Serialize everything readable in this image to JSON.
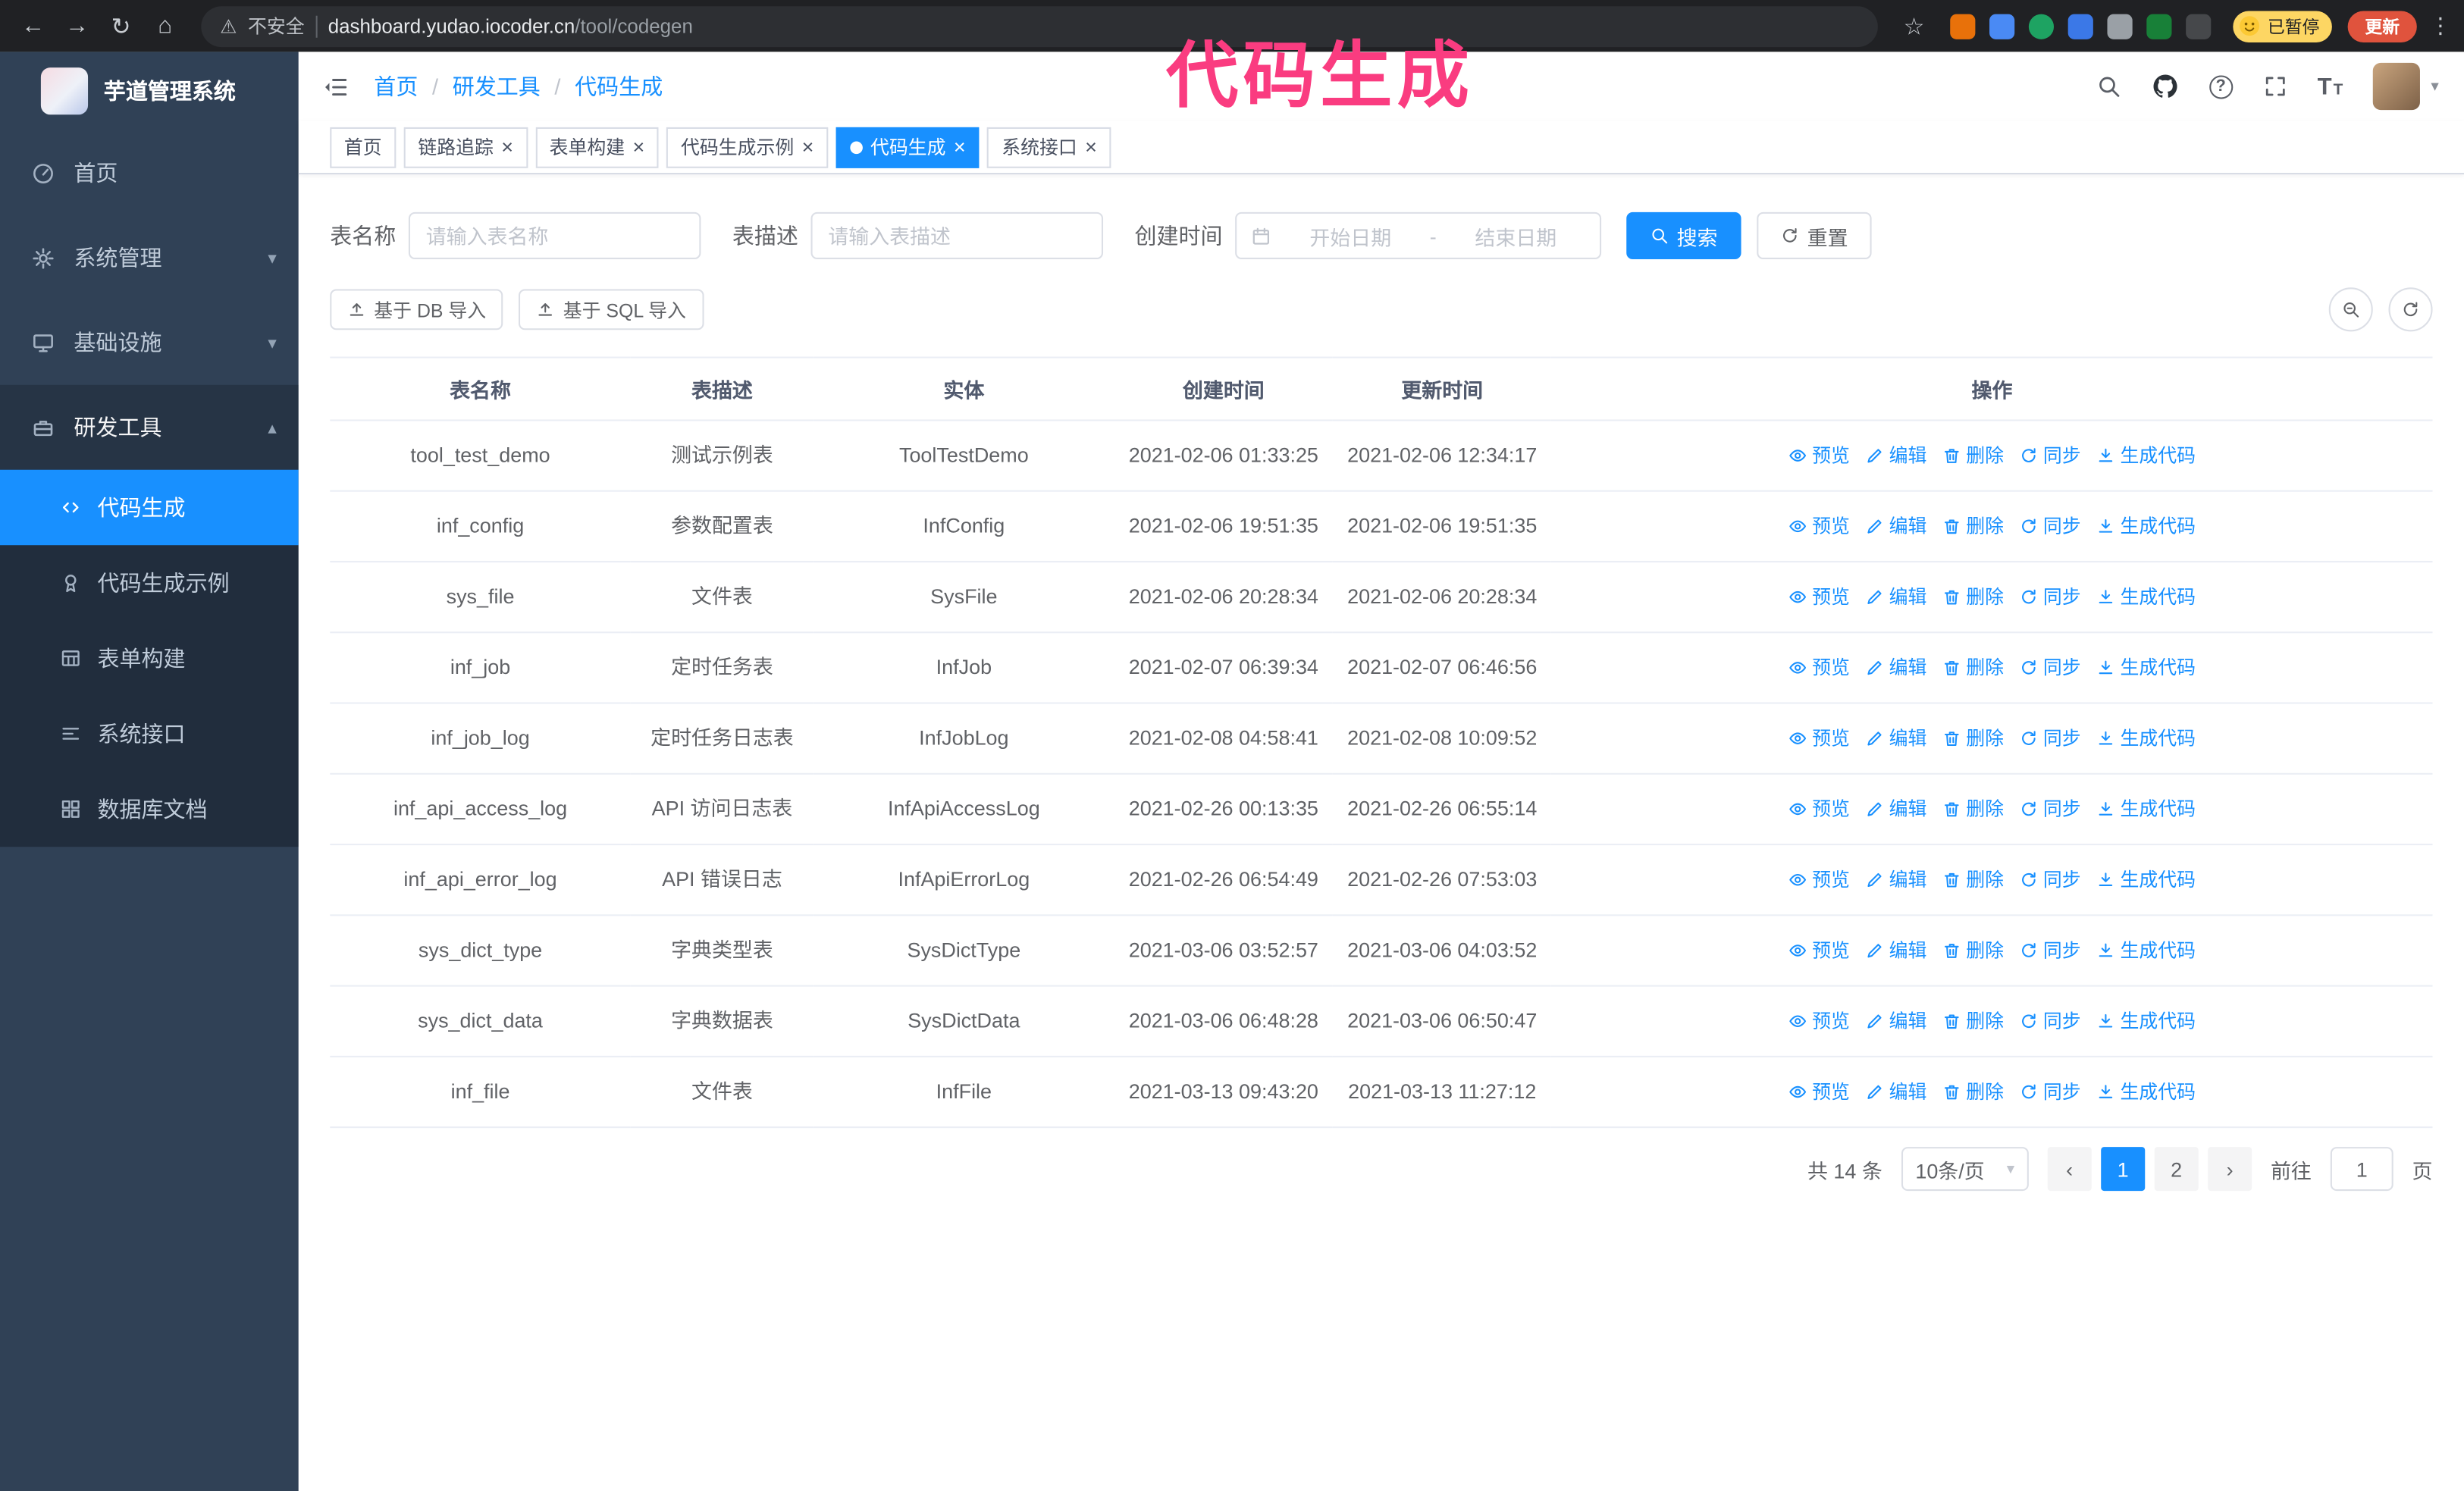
{
  "colors": {
    "primary": "#1890ff",
    "link": "#1890ff",
    "sidebar_bg": "#304156",
    "submenu_bg": "#212d3d",
    "parent_active_bg": "#263445",
    "annotation": "#fa3c80",
    "browser_bar": "#202124",
    "paused_badge_bg": "#fdd663",
    "update_button_bg": "#e0533d"
  },
  "browser": {
    "security_label": "不安全",
    "url_host": "dashboard.yudao.iocoder.cn",
    "url_path": "/tool/codegen",
    "paused_badge": "已暂停",
    "update_button": "更新",
    "extensions": [
      {
        "color": "#e8710a"
      },
      {
        "color": "#4a8af4"
      },
      {
        "color": "#1ea362"
      },
      {
        "color": "#3b78e7"
      },
      {
        "color": "#9aa0a6"
      },
      {
        "color": "#188038"
      },
      {
        "color": "#46484b"
      }
    ]
  },
  "annotation": {
    "text": "代码生成"
  },
  "sidebar": {
    "logo_title": "芋道管理系统",
    "items": [
      {
        "id": "home",
        "label": "首页",
        "icon": "dashboard-icon"
      },
      {
        "id": "system",
        "label": "系统管理",
        "icon": "gear-icon",
        "chevron": "down"
      },
      {
        "id": "infra",
        "label": "基础设施",
        "icon": "infra-icon",
        "chevron": "down"
      },
      {
        "id": "devtools",
        "label": "研发工具",
        "icon": "tools-icon",
        "chevron": "up",
        "expanded": true
      }
    ],
    "subitems": [
      {
        "id": "codegen",
        "label": "代码生成",
        "icon": "code-icon",
        "active": true
      },
      {
        "id": "codegen-example",
        "label": "代码生成示例",
        "icon": "example-icon"
      },
      {
        "id": "form-builder",
        "label": "表单构建",
        "icon": "form-icon"
      },
      {
        "id": "system-api",
        "label": "系统接口",
        "icon": "api-icon"
      },
      {
        "id": "db-doc",
        "label": "数据库文档",
        "icon": "dbdoc-icon"
      }
    ]
  },
  "header": {
    "breadcrumb": [
      "首页",
      "研发工具",
      "代码生成"
    ]
  },
  "tabs": [
    {
      "id": "home",
      "label": "首页",
      "closable": false,
      "active": false
    },
    {
      "id": "tracer",
      "label": "链路追踪",
      "closable": true,
      "active": false
    },
    {
      "id": "form-builder",
      "label": "表单构建",
      "closable": true,
      "active": false
    },
    {
      "id": "codegen-example",
      "label": "代码生成示例",
      "closable": true,
      "active": false
    },
    {
      "id": "codegen",
      "label": "代码生成",
      "closable": true,
      "active": true
    },
    {
      "id": "system-api",
      "label": "系统接口",
      "closable": true,
      "active": false
    }
  ],
  "filters": {
    "table_name_label": "表名称",
    "table_name_placeholder": "请输入表名称",
    "table_desc_label": "表描述",
    "table_desc_placeholder": "请输入表描述",
    "create_time_label": "创建时间",
    "date_start_placeholder": "开始日期",
    "date_separator": "-",
    "date_end_placeholder": "结束日期",
    "search_button": "搜索",
    "reset_button": "重置"
  },
  "toolbar": {
    "import_db": "基于 DB 导入",
    "import_sql": "基于 SQL 导入"
  },
  "table": {
    "columns": [
      "表名称",
      "表描述",
      "实体",
      "创建时间",
      "更新时间",
      "操作"
    ],
    "actions": [
      {
        "id": "preview",
        "label": "预览",
        "icon": "eye-icon"
      },
      {
        "id": "edit",
        "label": "编辑",
        "icon": "edit-icon"
      },
      {
        "id": "delete",
        "label": "删除",
        "icon": "delete-icon"
      },
      {
        "id": "sync",
        "label": "同步",
        "icon": "sync-icon"
      },
      {
        "id": "generate",
        "label": "生成代码",
        "icon": "generate-icon"
      }
    ],
    "rows": [
      {
        "name": "tool_test_demo",
        "desc": "测试示例表",
        "entity": "ToolTestDemo",
        "created": "2021-02-06 01:33:25",
        "updated": "2021-02-06 12:34:17"
      },
      {
        "name": "inf_config",
        "desc": "参数配置表",
        "entity": "InfConfig",
        "created": "2021-02-06 19:51:35",
        "updated": "2021-02-06 19:51:35"
      },
      {
        "name": "sys_file",
        "desc": "文件表",
        "entity": "SysFile",
        "created": "2021-02-06 20:28:34",
        "updated": "2021-02-06 20:28:34"
      },
      {
        "name": "inf_job",
        "desc": "定时任务表",
        "entity": "InfJob",
        "created": "2021-02-07 06:39:34",
        "updated": "2021-02-07 06:46:56"
      },
      {
        "name": "inf_job_log",
        "desc": "定时任务日志表",
        "entity": "InfJobLog",
        "created": "2021-02-08 04:58:41",
        "updated": "2021-02-08 10:09:52"
      },
      {
        "name": "inf_api_access_log",
        "desc": "API 访问日志表",
        "entity": "InfApiAccessLog",
        "created": "2021-02-26 00:13:35",
        "updated": "2021-02-26 06:55:14"
      },
      {
        "name": "inf_api_error_log",
        "desc": "API 错误日志",
        "entity": "InfApiErrorLog",
        "created": "2021-02-26 06:54:49",
        "updated": "2021-02-26 07:53:03"
      },
      {
        "name": "sys_dict_type",
        "desc": "字典类型表",
        "entity": "SysDictType",
        "created": "2021-03-06 03:52:57",
        "updated": "2021-03-06 04:03:52"
      },
      {
        "name": "sys_dict_data",
        "desc": "字典数据表",
        "entity": "SysDictData",
        "created": "2021-03-06 06:48:28",
        "updated": "2021-03-06 06:50:47"
      },
      {
        "name": "inf_file",
        "desc": "文件表",
        "entity": "InfFile",
        "created": "2021-03-13 09:43:20",
        "updated": "2021-03-13 11:27:12"
      }
    ]
  },
  "pagination": {
    "total_label": "共 14 条",
    "page_size_label": "10条/页",
    "pages": [
      "1",
      "2"
    ],
    "active_page": "1",
    "goto_label": "前往",
    "goto_value": "1",
    "goto_unit": "页"
  }
}
